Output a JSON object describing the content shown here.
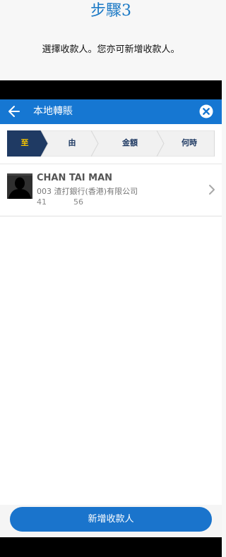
{
  "step_title": "步驟3",
  "step_desc": "選擇收款人。您亦可新增收款人。",
  "header": {
    "title": "本地轉賬"
  },
  "stepper": {
    "steps": [
      "至",
      "由",
      "金額",
      "何時"
    ],
    "active_color": "#1f3a63",
    "active_text_color": "#f5c400"
  },
  "payee": {
    "name": "CHAN TAI MAN",
    "bank": "003 渣打銀行(香港)有限公司",
    "account_part1": "41",
    "account_part2": "56"
  },
  "buttons": {
    "add_payee": "新增收款人"
  },
  "colors": {
    "brand_blue": "#1677d2",
    "title_blue": "#1b79c5"
  },
  "icons": {
    "back": "arrow-left-icon",
    "close": "close-circle-icon",
    "row": "chevron-right-icon",
    "avatar": "person-silhouette-icon"
  }
}
